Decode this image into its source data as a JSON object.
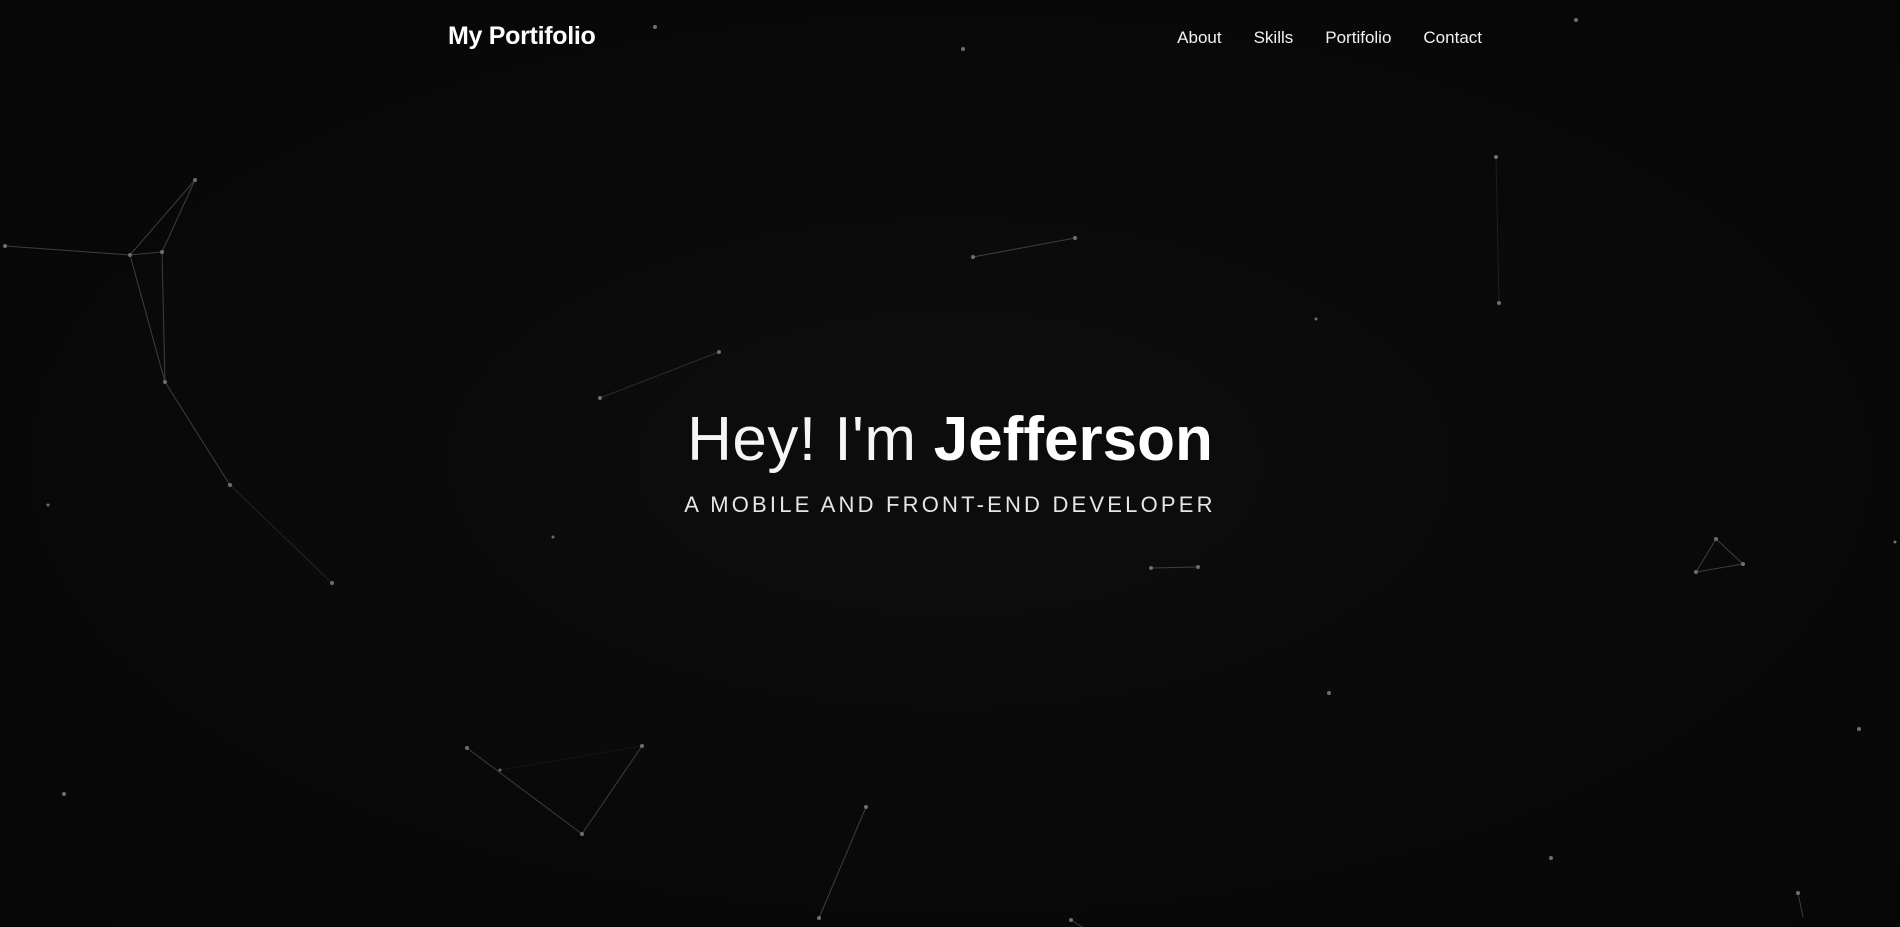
{
  "navbar": {
    "brand": "My Portifolio",
    "links": [
      {
        "label": "About"
      },
      {
        "label": "Skills"
      },
      {
        "label": "Portifolio"
      },
      {
        "label": "Contact"
      }
    ]
  },
  "hero": {
    "greeting": "Hey! I'm",
    "name": "Jefferson",
    "subtitle": "A MOBILE AND FRONT-END DEVELOPER"
  },
  "theme": {
    "background": "#0a0a0a",
    "text": "#ffffff",
    "particle": "#6b6b6b"
  }
}
